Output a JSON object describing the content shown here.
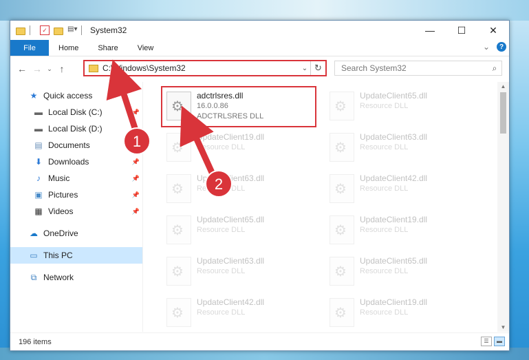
{
  "window": {
    "title": "System32"
  },
  "window_controls": {
    "minimize": "—",
    "maximize": "☐",
    "close": "✕"
  },
  "ribbon": {
    "tabs": [
      "File",
      "Home",
      "Share",
      "View"
    ],
    "expand": "⌄"
  },
  "address": {
    "path": "C:\\Windows\\System32",
    "search_placeholder": "Search System32"
  },
  "sidebar": {
    "items": [
      {
        "label": "Quick access",
        "icon": "star-icon"
      },
      {
        "label": "Local Disk (C:)",
        "icon": "drive-icon"
      },
      {
        "label": "Local Disk (D:)",
        "icon": "drive-icon"
      },
      {
        "label": "Documents",
        "icon": "documents-icon"
      },
      {
        "label": "Downloads",
        "icon": "download-icon"
      },
      {
        "label": "Music",
        "icon": "music-icon"
      },
      {
        "label": "Pictures",
        "icon": "pictures-icon"
      },
      {
        "label": "Videos",
        "icon": "videos-icon"
      },
      {
        "label": "OneDrive",
        "icon": "cloud-icon"
      },
      {
        "label": "This PC",
        "icon": "computer-icon"
      },
      {
        "label": "Network",
        "icon": "network-icon"
      }
    ]
  },
  "files": {
    "highlighted": {
      "name": "adctrlsres.dll",
      "version": "16.0.0.86",
      "description": "ADCTRLSRES DLL"
    },
    "faded": [
      {
        "name": "UpdateClient65.dll",
        "type": "Resource DLL"
      },
      {
        "name": "UpdateClient19.dll",
        "type": "Resource DLL"
      },
      {
        "name": "UpdateClient63.dll",
        "type": "Resource DLL"
      },
      {
        "name": "UpdateClient63.dll",
        "type": "Resource DLL"
      },
      {
        "name": "UpdateClient42.dll",
        "type": "Resource DLL"
      },
      {
        "name": "UpdateClient65.dll",
        "type": "Resource DLL"
      },
      {
        "name": "UpdateClient19.dll",
        "type": "Resource DLL"
      },
      {
        "name": "UpdateClient63.dll",
        "type": "Resource DLL"
      },
      {
        "name": "UpdateClient65.dll",
        "type": "Resource DLL"
      },
      {
        "name": "UpdateClient42.dll",
        "type": "Resource DLL"
      },
      {
        "name": "UpdateClient19.dll",
        "type": "Resource DLL"
      }
    ]
  },
  "status": {
    "item_count": "196 items"
  },
  "annotations": {
    "step1": "1",
    "step2": "2",
    "color": "#d9343a"
  }
}
